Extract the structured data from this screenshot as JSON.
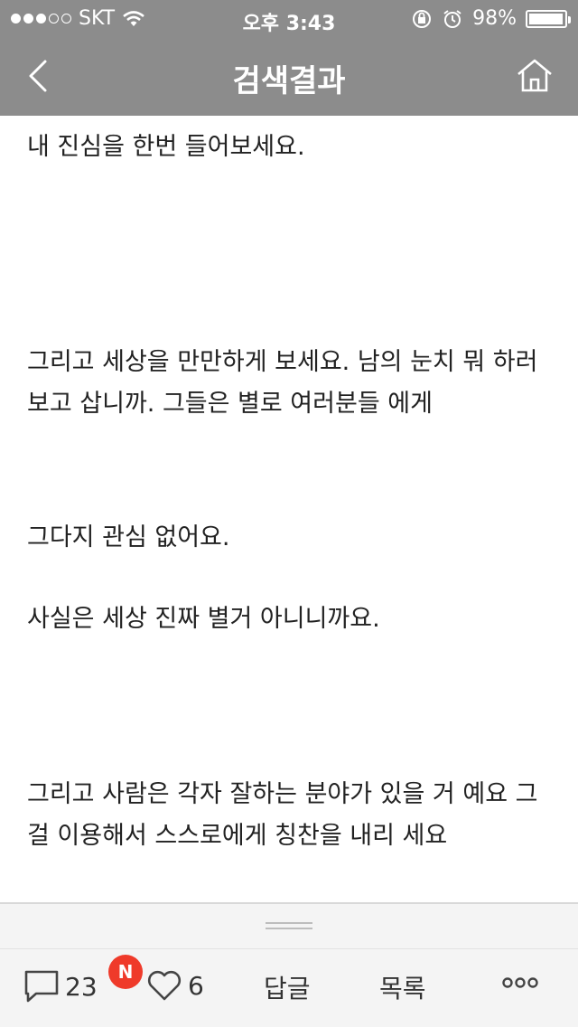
{
  "status_bar": {
    "carrier": "SKT",
    "signal_dots_filled": 3,
    "signal_dots_total": 5,
    "time": "오후 3:43",
    "battery_percent": "98%",
    "battery_level": 0.98,
    "icons": [
      "wifi-icon",
      "orientation-lock-icon",
      "alarm-icon",
      "battery-icon"
    ]
  },
  "nav": {
    "title": "검색결과",
    "back_icon": "chevron-left-icon",
    "home_icon": "home-icon"
  },
  "article": {
    "paragraphs": [
      "내 진심을 한번 들어보세요.",
      "그리고 세상을 만만하게 보세요. 남의 눈치 뭐 하러보고 삽니까. 그들은 별로 여러분들 에게",
      "그다지 관심 없어요.",
      "사실은 세상 진짜 별거 아니니까요.",
      "그리고 사람은 각자 잘하는 분야가 있을 거 예요 그걸 이용해서 스스로에게 칭찬을 내리 세요"
    ]
  },
  "toolbar": {
    "comment_count": "23",
    "new_badge": "N",
    "like_count": "6",
    "reply_label": "답글",
    "list_label": "목록",
    "more_label": "ooo"
  },
  "colors": {
    "header_bg": "#8c8c8c",
    "badge": "#ef3a2a",
    "toolbar_bg": "#f4f4f4"
  }
}
